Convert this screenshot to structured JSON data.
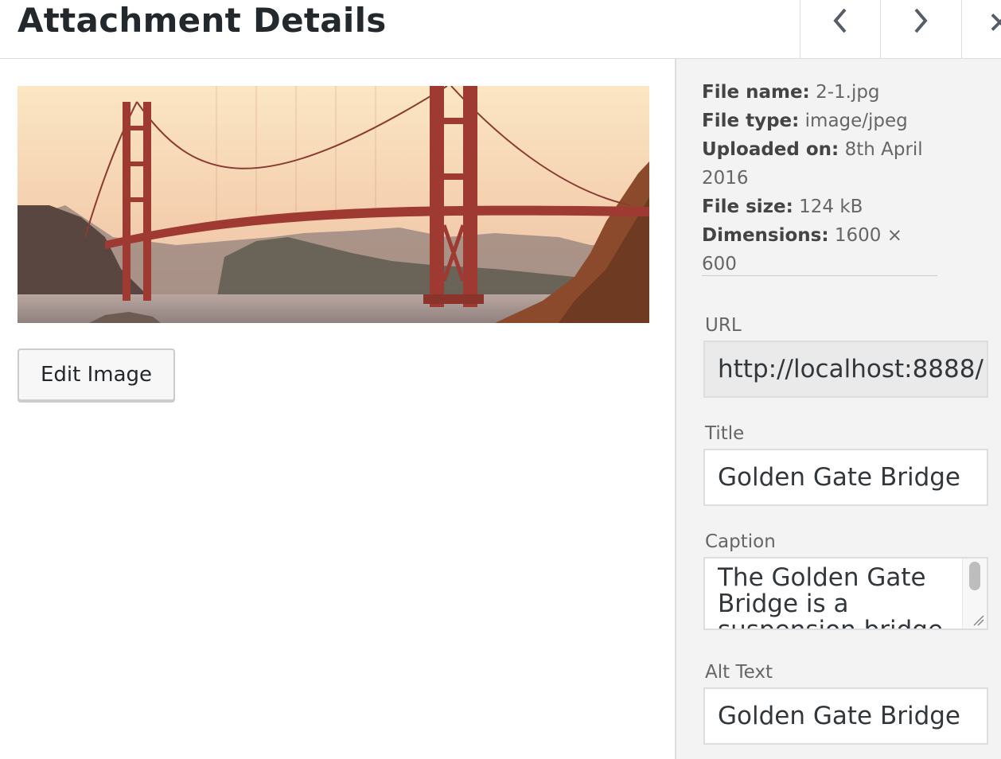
{
  "header": {
    "title": "Attachment Details",
    "prev_icon": "chevron-left-icon",
    "next_icon": "chevron-right-icon",
    "close_icon": "close-icon"
  },
  "main": {
    "preview_alt": "Golden Gate Bridge",
    "edit_button_label": "Edit Image"
  },
  "details": {
    "file_name_label": "File name:",
    "file_name": "2-1.jpg",
    "file_type_label": "File type:",
    "file_type": "image/jpeg",
    "uploaded_label": "Uploaded on:",
    "uploaded_line1": "8th April",
    "uploaded_line2": "2016",
    "file_size_label": "File size:",
    "file_size": "124 kB",
    "dimensions_label": "Dimensions:",
    "dimensions": "1600 × 600"
  },
  "fields": {
    "url_label": "URL",
    "url_value": "http://localhost:8888/",
    "title_label": "Title",
    "title_value": "Golden Gate Bridge",
    "caption_label": "Caption",
    "caption_value": "The Golden Gate Bridge is a suspension bridge",
    "alt_label": "Alt Text",
    "alt_value": "Golden Gate Bridge"
  },
  "colors": {
    "sidebar_bg": "#f3f3f3",
    "border": "#dddddd",
    "bridge_red": "#9e3a32"
  }
}
